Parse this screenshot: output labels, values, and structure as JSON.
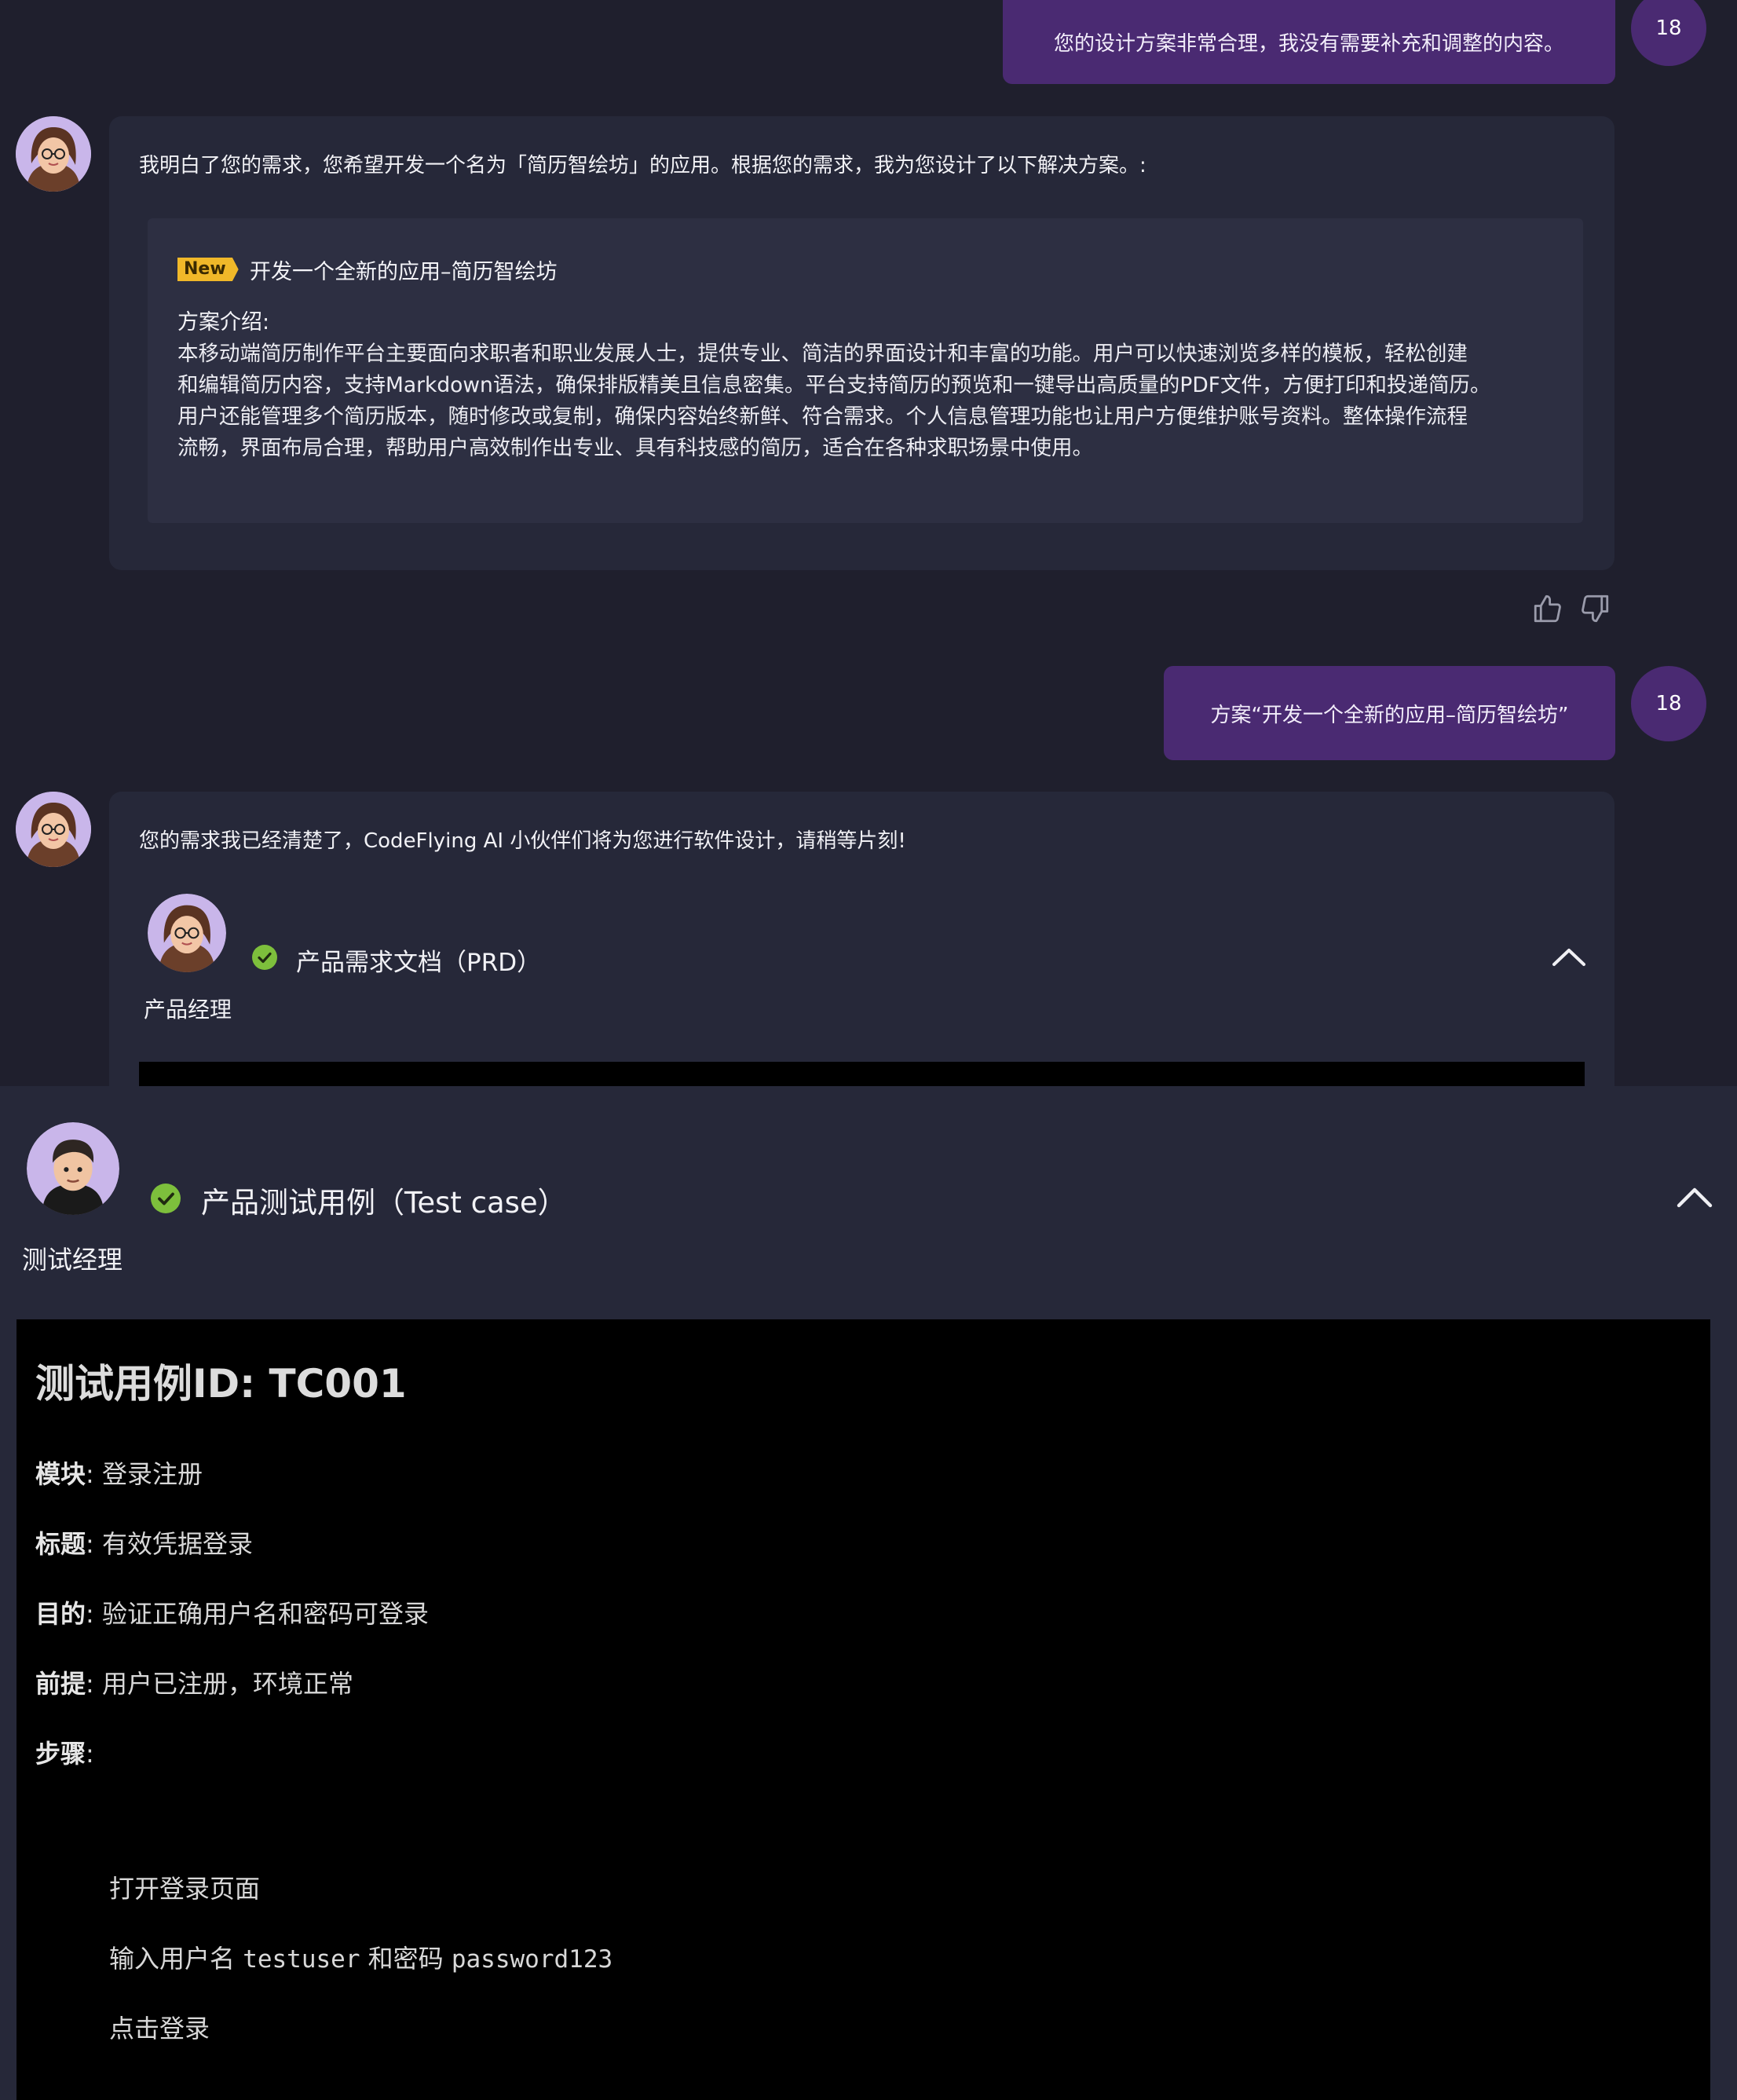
{
  "conversation": {
    "msg1_user": {
      "text": "您的设计方案非常合理，我没有需要补充和调整的内容。",
      "avatar_label": "18"
    },
    "msg2_ai": {
      "intro": "我明白了您的需求，您希望开发一个名为「简历智绘坊」的应用。根据您的需求，我为您设计了以下解决方案。:",
      "plan_card": {
        "badge": "New",
        "title": "开发一个全新的应用–简历智绘坊",
        "intro_label": "方案介绍:",
        "description_lines": [
          "本移动端简历制作平台主要面向求职者和职业发展人士，提供专业、简洁的界面设计和丰富的功能。用户可以快速浏览多样的模板，轻松创建",
          "和编辑简历内容，支持Markdown语法，确保排版精美且信息密集。平台支持简历的预览和一键导出高质量的PDF文件，方便打印和投递简历。",
          "用户还能管理多个简历版本，随时修改或复制，确保内容始终新鲜、符合需求。个人信息管理功能也让用户方便维护账号资料。整体操作流程",
          "流畅，界面布局合理，帮助用户高效制作出专业、具有科技感的简历，适合在各种求职场景中使用。"
        ]
      },
      "feedback": {
        "like_icon": "thumbs-up-icon",
        "dislike_icon": "thumbs-down-icon"
      }
    },
    "msg3_user": {
      "text": "方案“开发一个全新的应用–简历智绘坊”",
      "avatar_label": "18"
    },
    "msg4_ai": {
      "intro": "您的需求我已经清楚了，CodeFlying AI 小伙伴们将为您进行软件设计，请稍等片刻!",
      "prd_section": {
        "title": "产品需求文档（PRD）",
        "role": "产品经理",
        "status_icon": "check-circle-icon",
        "toggle_icon": "chevron-up-icon"
      }
    }
  },
  "test_section": {
    "title": "产品测试用例（Test case）",
    "role": "测试经理",
    "status_icon": "check-circle-icon",
    "toggle_icon": "chevron-up-icon",
    "document": {
      "heading": "测试用例ID: TC001",
      "fields": [
        {
          "label": "模块",
          "value": " 登录注册"
        },
        {
          "label": "标题",
          "value": " 有效凭据登录"
        },
        {
          "label": "目的",
          "value": " 验证正确用户名和密码可登录"
        },
        {
          "label": "前提",
          "value": " 用户已注册，环境正常"
        },
        {
          "label": "步骤",
          "value": ""
        }
      ],
      "steps": {
        "step1": "打开登录页面",
        "step2_prefix": "输入用户名 ",
        "step2_user": "testuser",
        "step2_mid": " 和密码 ",
        "step2_pass": "password123",
        "step3": "点击登录"
      }
    }
  },
  "colors": {
    "background": "#1f1f2d",
    "ai_bubble": "#262839",
    "user_bubble": "#4a2a72",
    "new_badge": "#f0b829",
    "check_green": "#7dbf3c",
    "doc_background": "#000000"
  }
}
